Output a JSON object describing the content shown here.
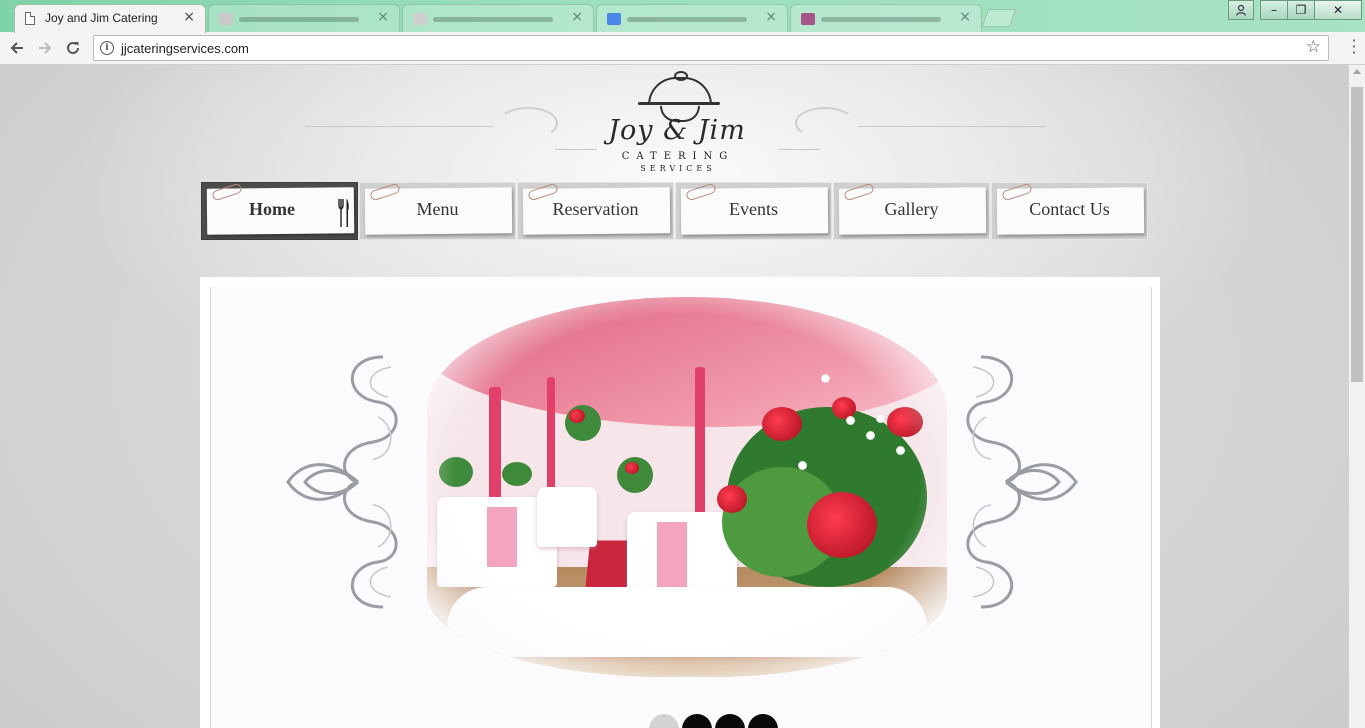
{
  "browser": {
    "active_tab": {
      "title": "Joy and Jim Catering",
      "close_glyph": "×"
    },
    "inactive_tabs": [
      {
        "favicon_color": "#c9c9c9"
      },
      {
        "favicon_color": "#cfcfcf"
      },
      {
        "favicon_color": "#4a86e8"
      },
      {
        "favicon_color": "#a4568a"
      }
    ],
    "url": "jjcateringservices.com",
    "icons": {
      "back": "arrow-left-icon",
      "forward": "arrow-right-icon",
      "reload": "reload-icon",
      "info": "info-icon",
      "bookmark": "star-icon",
      "menu": "kebab-menu-icon"
    },
    "window_controls": {
      "minimize": "–",
      "maximize": "❐",
      "close": "✕"
    }
  },
  "logo": {
    "script": "Joy & Jim",
    "line1": "CATERING",
    "line2": "SERVICES"
  },
  "nav": {
    "items": [
      {
        "label": "Home",
        "active": true
      },
      {
        "label": "Menu",
        "active": false
      },
      {
        "label": "Reservation",
        "active": false
      },
      {
        "label": "Events",
        "active": false
      },
      {
        "label": "Gallery",
        "active": false
      },
      {
        "label": "Contact Us",
        "active": false
      }
    ]
  },
  "slideshow": {
    "image": "catering-tent-roses-photo",
    "slide_count": 4,
    "current_slide": 1
  },
  "colors": {
    "active_nav_bg": "#4c4c4c",
    "nav_bg": "#cfcfcf",
    "tent_pink": "#e77b93",
    "rose_red": "#d4162b",
    "dot_active": "#d3d3d3",
    "dot_inactive": "#0a0a0a"
  }
}
